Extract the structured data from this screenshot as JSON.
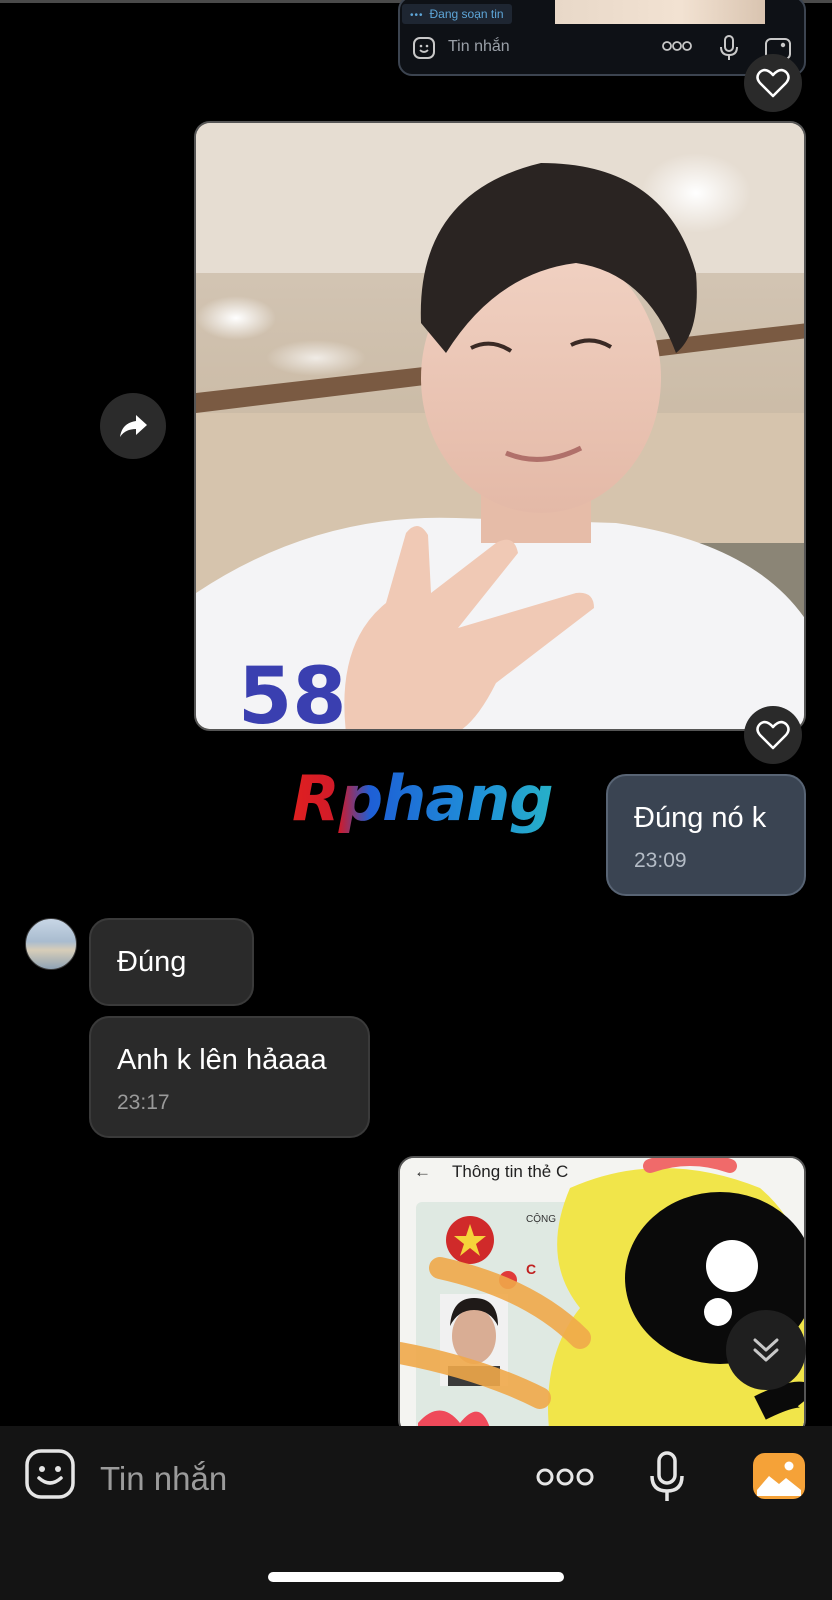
{
  "quoted_screenshot": {
    "typing_status": "Đang soạn tin",
    "placeholder": "Tin nhắn"
  },
  "messages": {
    "outgoing_1": {
      "text": "Đúng nó k",
      "time": "23:09"
    },
    "incoming_1": {
      "text": "Đúng"
    },
    "incoming_2": {
      "text": "Anh k lên hảaaa",
      "time": "23:17"
    },
    "id_card_image": {
      "header": "Thông tin thẻ C"
    }
  },
  "watermark": {
    "text": "Rphang"
  },
  "composer": {
    "placeholder": "Tin nhắn"
  },
  "icons": [
    "heart-icon",
    "share-arrow-icon",
    "sticker-smile-icon",
    "more-dots-icon",
    "microphone-icon",
    "gallery-icon",
    "chevron-double-down-icon"
  ],
  "colors": {
    "background": "#000000",
    "outgoing_bubble": "#3a4452",
    "incoming_bubble": "#2a2a2a",
    "gallery_accent": "#f5a238"
  }
}
